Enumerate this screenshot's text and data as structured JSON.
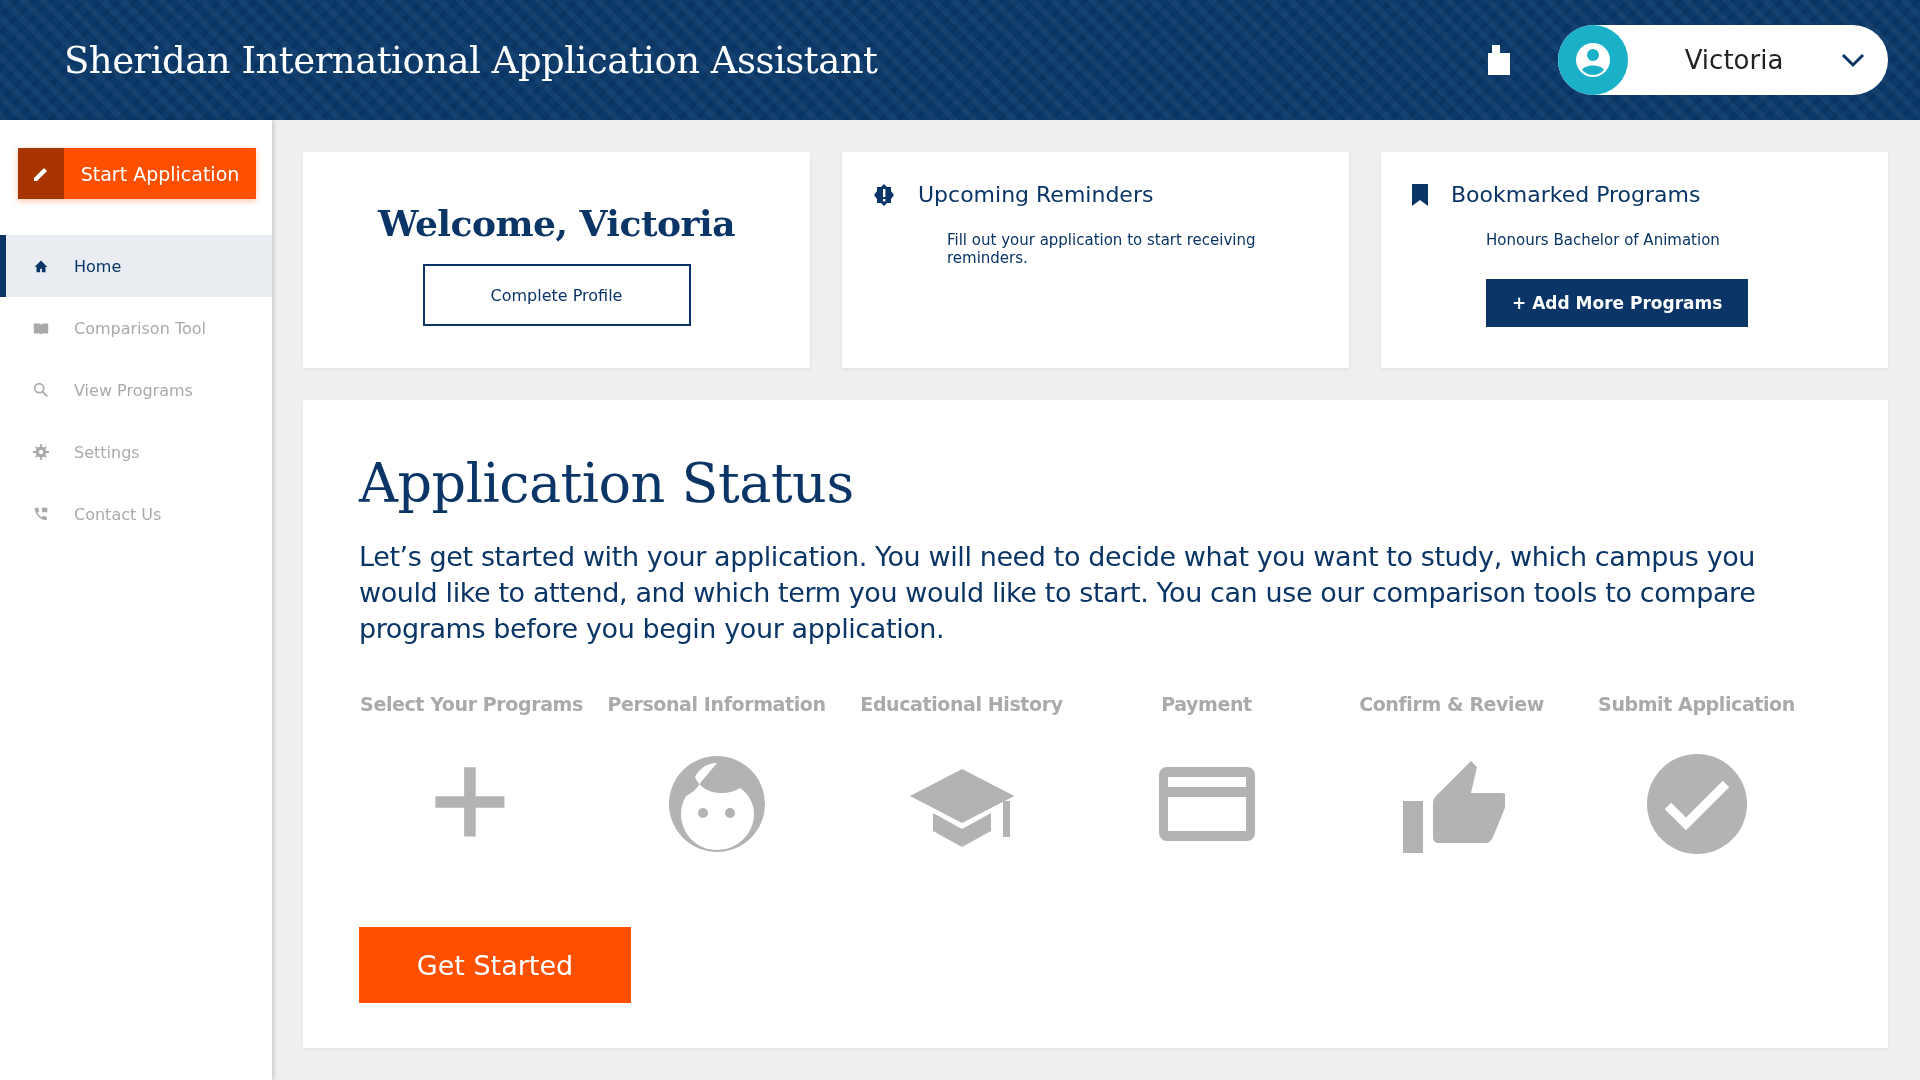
{
  "header": {
    "title": "Sheridan International Application Assistant",
    "user": {
      "name": "Victoria"
    }
  },
  "sidebar": {
    "start_button": "Start Application",
    "items": [
      {
        "label": "Home",
        "kind": "home",
        "selected": true
      },
      {
        "label": "Comparison Tool",
        "kind": "book",
        "selected": false
      },
      {
        "label": "View Programs",
        "kind": "search",
        "selected": false
      },
      {
        "label": "Settings",
        "kind": "gear",
        "selected": false
      },
      {
        "label": "Contact Us",
        "kind": "phone",
        "selected": false
      }
    ]
  },
  "welcome": {
    "title": "Welcome, Victoria",
    "button": "Complete Profile"
  },
  "reminders": {
    "title": "Upcoming Reminders",
    "text": "Fill out your application to start receiving reminders."
  },
  "bookmarks": {
    "title": "Bookmarked Programs",
    "programs": [
      "Honours Bachelor of Animation"
    ],
    "button": "+ Add More Programs"
  },
  "status": {
    "title": "Application Status",
    "text": "Let’s get started with your application. You will need to decide what you want to study, which campus you would like to attend, and which term you would like to start. You can use our comparison tools to compare programs before you begin your application.",
    "steps": [
      {
        "label": "Select Your Programs",
        "kind": "plus"
      },
      {
        "label": "Personal Information",
        "kind": "face"
      },
      {
        "label": "Educational History",
        "kind": "cap"
      },
      {
        "label": "Payment",
        "kind": "card"
      },
      {
        "label": "Confirm & Review",
        "kind": "thumb"
      },
      {
        "label": "Submit Application",
        "kind": "check"
      }
    ],
    "button": "Get Started"
  }
}
